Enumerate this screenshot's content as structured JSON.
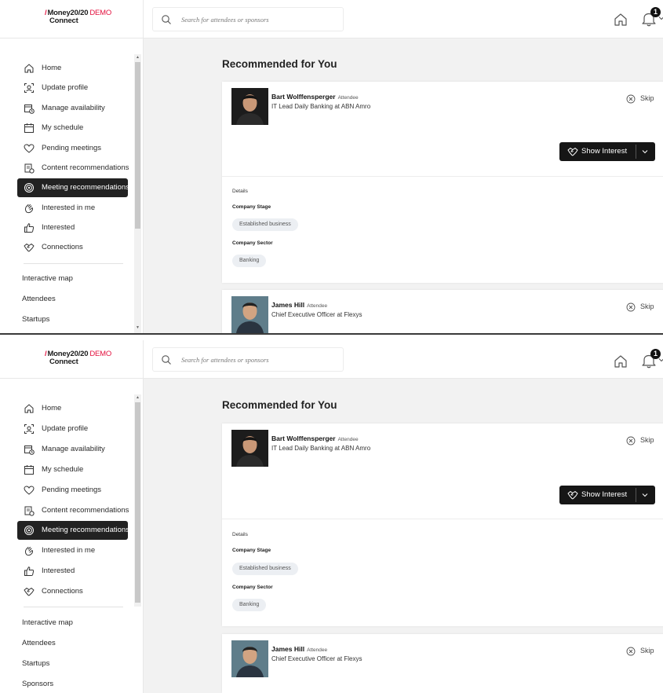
{
  "brand": {
    "slash": "/",
    "name": "Money20/20",
    "demo": "DEMO",
    "sub": "Connect",
    "accent": "#e3123f"
  },
  "search": {
    "placeholder": "Search for attendees or sponsors",
    "icon": "search-icon"
  },
  "header": {
    "notification_count": "1",
    "home_icon": "home-icon",
    "bell_icon": "bell-icon"
  },
  "sidebar": {
    "items": [
      {
        "label": "Home",
        "icon": "home-icon"
      },
      {
        "label": "Update profile",
        "icon": "scan-face-icon"
      },
      {
        "label": "Manage availability",
        "icon": "calendar-clock-icon"
      },
      {
        "label": "My schedule",
        "icon": "calendar-icon"
      },
      {
        "label": "Pending meetings",
        "icon": "heart-icon"
      },
      {
        "label": "Content recommendations",
        "icon": "content-reco-icon"
      },
      {
        "label": "Meeting recommendations",
        "icon": "target-icon",
        "active": true
      },
      {
        "label": "Interested in me",
        "icon": "waving-hand-icon"
      },
      {
        "label": "Interested",
        "icon": "thumbs-up-icon"
      },
      {
        "label": "Connections",
        "icon": "handshake-icon"
      }
    ],
    "links": [
      "Interactive map",
      "Attendees",
      "Startups",
      "Sponsors"
    ]
  },
  "main": {
    "title": "Recommended for You",
    "skip_label": "Skip",
    "show_interest_label": "Show Interest",
    "cards": [
      {
        "name": "Bart Wolffensperger",
        "role": "Attendee",
        "title": "IT Lead Daily Banking at ABN Amro",
        "details_label": "Details",
        "company_stage_label": "Company Stage",
        "company_stage": "Established business",
        "company_sector_label": "Company Sector",
        "company_sector": "Banking"
      },
      {
        "name": "James Hill",
        "role": "Attendee",
        "title": "Chief Executive Officer at Flexys"
      }
    ]
  }
}
